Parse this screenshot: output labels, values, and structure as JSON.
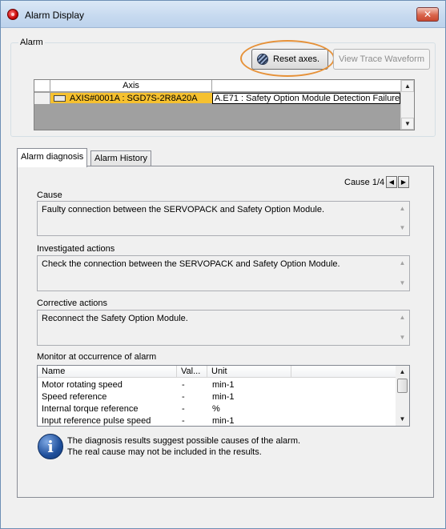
{
  "window": {
    "title": "Alarm Display",
    "close_symbol": "✕"
  },
  "alarm_group": {
    "legend": "Alarm",
    "reset_button": "Reset axes.",
    "view_trace_button": "View Trace Waveform",
    "grid": {
      "column_header": "Axis",
      "row": {
        "axis": "AXIS#0001A : SGD7S-2R8A20A",
        "alarm": "A.E71 : Safety Option Module Detection Failure"
      }
    }
  },
  "tabs": {
    "diagnosis": "Alarm diagnosis",
    "history": "Alarm History"
  },
  "diagnosis": {
    "cause_counter": "Cause 1/4",
    "cause_label": "Cause",
    "cause_text": "Faulty connection between the SERVOPACK and Safety Option Module.",
    "investigated_label": "Investigated actions",
    "investigated_text": "Check the connection between the SERVOPACK and Safety Option Module.",
    "corrective_label": "Corrective actions",
    "corrective_text": "Reconnect the Safety Option Module.",
    "monitor_label": "Monitor at occurrence of alarm",
    "monitor_columns": [
      "Name",
      "Val...",
      "Unit"
    ],
    "monitor_rows": [
      {
        "name": "Motor rotating speed",
        "value": "-",
        "unit": "min-1"
      },
      {
        "name": "Speed reference",
        "value": "-",
        "unit": "min-1"
      },
      {
        "name": "Internal torque reference",
        "value": "-",
        "unit": "%"
      },
      {
        "name": "Input reference pulse speed",
        "value": "-",
        "unit": "min-1"
      }
    ],
    "note_line1": "The diagnosis results suggest possible causes of the alarm.",
    "note_line2": "The real cause may not be included in the results."
  },
  "colors": {
    "selected_row": "#f6c12f",
    "highlight_ellipse": "#e69138"
  }
}
